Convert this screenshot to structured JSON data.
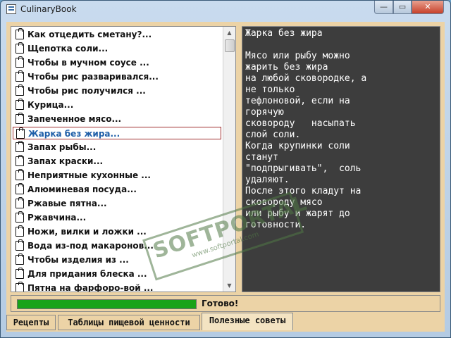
{
  "window": {
    "title": "CulinaryBook",
    "minimize": "—",
    "maximize": "▭",
    "close": "✕"
  },
  "list": {
    "items": [
      {
        "label": "Как отцедить сметану?..."
      },
      {
        "label": "Щепотка соли..."
      },
      {
        "label": "Чтобы в мучном соусе ..."
      },
      {
        "label": "Чтобы рис разваривался..."
      },
      {
        "label": "Чтобы рис получился ..."
      },
      {
        "label": "Курица..."
      },
      {
        "label": "Запеченное мясо..."
      },
      {
        "label": "Жарка без жира..."
      },
      {
        "label": "Запах рыбы..."
      },
      {
        "label": "Запах краски..."
      },
      {
        "label": "Неприятные кухонные ..."
      },
      {
        "label": "Алюминевая посуда..."
      },
      {
        "label": "Ржавые пятна..."
      },
      {
        "label": "Ржавчина..."
      },
      {
        "label": "Ножи, вилки и ложки ..."
      },
      {
        "label": "Вода из-под макаронов..."
      },
      {
        "label": "Чтобы изделия из ..."
      },
      {
        "label": "Для придания блеска ..."
      },
      {
        "label": "Пятна на фарфоро-вой ..."
      }
    ],
    "selected_index": 7,
    "scroll_up": "▲",
    "scroll_down": "▼"
  },
  "article": {
    "title": "Жарка без жира",
    "lines": [
      "Мясо или рыбу можно",
      "жарить без жира",
      "на любой сковородке, а",
      "не только",
      "тефлоновой, если на",
      "горячую",
      "сковороду   насыпать",
      "слой соли.",
      "Когда крупинки соли",
      "станут",
      "\"подпрыгивать\",  соль",
      "удаляют.",
      "После этого кладут на",
      "сковороду мясо",
      "или рыбу и жарят до",
      "готовности."
    ]
  },
  "status": {
    "progress": 1.0,
    "text": "Готово!"
  },
  "tabs": [
    {
      "label": "Рецепты"
    },
    {
      "label": "Таблицы пищевой ценности"
    },
    {
      "label": "Полезные советы"
    }
  ],
  "watermark": {
    "text": "SOFTPORTAL",
    "url": "www.softportal.com"
  },
  "colors": {
    "progress": "#19a319",
    "panel": "#ecd3a6",
    "article_bg": "#3d3d3d",
    "selected_text": "#1f5fa8"
  }
}
